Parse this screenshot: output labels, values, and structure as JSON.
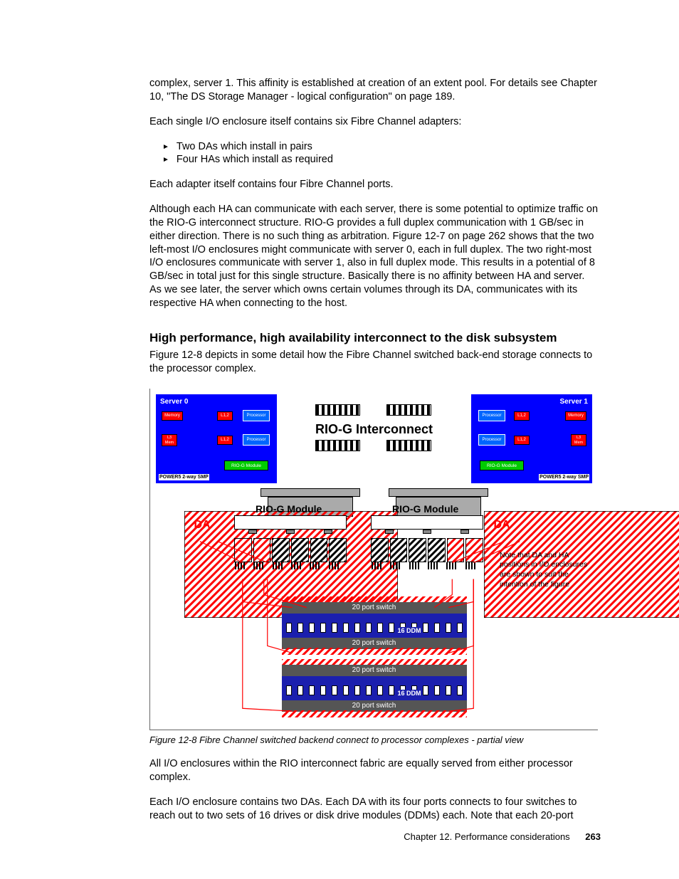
{
  "paragraphs": {
    "p1": "complex, server 1. This affinity is established at creation of an extent pool. For details see Chapter 10, \"The DS Storage Manager - logical configuration\" on page 189.",
    "p2": "Each single I/O enclosure itself contains six Fibre Channel adapters:",
    "li1": "Two DAs which install in pairs",
    "li2": "Four HAs which install as required",
    "p3": "Each adapter itself contains four Fibre Channel ports.",
    "p4": "Although each HA can communicate with each server, there is some potential to optimize traffic on the RIO-G interconnect structure. RIO-G provides a full duplex communication with 1 GB/sec in either direction. There is no such thing as arbitration. Figure 12-7 on page 262 shows that the two left-most I/O enclosures might communicate with server 0, each in full duplex. The two right-most I/O enclosures communicate with server 1, also in full duplex mode. This results in a potential of 8 GB/sec in total just for this single structure. Basically there is no affinity between HA and server. As we see later, the server which owns certain volumes through its DA, communicates with its respective HA when connecting to the host.",
    "heading": "High performance, high availability interconnect to the disk subsystem",
    "p5": "Figure 12-8 depicts in some detail how the Fibre Channel switched back-end storage connects to the processor complex.",
    "p6": "All I/O enclosures within the RIO interconnect fabric are equally served from either processor complex.",
    "p7": "Each I/O enclosure contains two DAs. Each DA with its four ports connects to four switches to reach out to two sets of 16 drives or disk drive modules (DDMs) each. Note that each 20-port"
  },
  "figure": {
    "caption": "Figure 12-8   Fibre Channel switched backend connect to processor complexes - partial view",
    "server0": "Server 0",
    "server1": "Server 1",
    "memory": "Memory",
    "l12": "L1,2\nMemory",
    "l3": "L3\nMemory",
    "processor": "Processor",
    "riog_module": "RIO-G Module",
    "smp": "POWER5 2-way SMP",
    "interconnect": "RIO-G Interconnect",
    "da": "DA",
    "riog_mod_big": "RIO-G Module",
    "note": "Note that DA and HA positions in I/O enclosures are shown to suit the intention of the figure",
    "switch": "20 port switch",
    "ddm": "16 DDM"
  },
  "footer": {
    "chapter": "Chapter 12. Performance considerations",
    "page": "263"
  },
  "chart_data": {
    "type": "diagram",
    "title": "Fibre Channel switched backend connect to processor complexes - partial view",
    "components": {
      "servers": [
        {
          "name": "Server 0",
          "smp": "POWER5 2-way SMP",
          "chips": [
            "Memory",
            "L1,2 Memory",
            "Processor",
            "L3 Memory"
          ],
          "modules": [
            "RIO-G Module"
          ]
        },
        {
          "name": "Server 1",
          "smp": "POWER5 2-way SMP",
          "chips": [
            "Memory",
            "L1,2 Memory",
            "Processor",
            "L3 Memory"
          ],
          "modules": [
            "RIO-G Module"
          ]
        }
      ],
      "interconnect": "RIO-G Interconnect",
      "io_enclosures": 2,
      "io_enclosure_contents": {
        "RIO-G Module": 1,
        "DA": 2,
        "HA": 4
      },
      "external_da_boxes": 2,
      "switch_ddm_stacks": [
        {
          "switch_top": "20 port switch",
          "ddm": "16 DDM",
          "switch_bottom": "20 port switch"
        },
        {
          "switch_top": "20 port switch",
          "ddm": "16 DDM",
          "switch_bottom": "20 port switch"
        }
      ],
      "note": "DA and HA positions in I/O enclosures are shown to suit the intention of the figure"
    }
  }
}
